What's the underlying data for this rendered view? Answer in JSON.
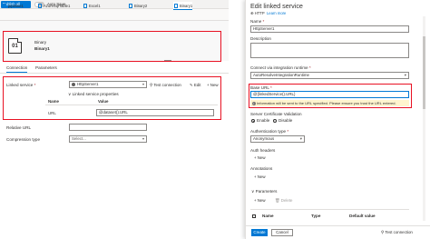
{
  "toolbar": {
    "publish_label": "Publish all",
    "autosave_label": "Auto Save"
  },
  "tabs": [
    {
      "label": "pipeline1"
    },
    {
      "label": "AzureSqlTable1"
    },
    {
      "label": "Excel1"
    },
    {
      "label": "Binary2"
    },
    {
      "label": "Binary1"
    }
  ],
  "dataset": {
    "icon_text": "01",
    "type": "Binary",
    "name": "Binary1"
  },
  "properties_tabs": {
    "connection": "Connection",
    "parameters": "Parameters"
  },
  "connection": {
    "linked_service_label": "Linked service",
    "linked_service_value": "HttpServer1",
    "test_connection": "Test connection",
    "edit": "Edit",
    "new": "New",
    "ls_properties_label": "Linked service properties",
    "grid_name_header": "Name",
    "grid_value_header": "Value",
    "property_name": "URL",
    "property_value": "@dataset().URL",
    "relative_url_label": "Relative URL",
    "compression_type_label": "Compression type",
    "compression_type_value": "Select..."
  },
  "panel": {
    "title": "Edit linked service",
    "subtitle_type": "HTTP",
    "learn_more": "Learn more",
    "name_label": "Name",
    "name_value": "HttpServer1",
    "description_label": "Description",
    "connect_via_label": "Connect via integration runtime",
    "connect_via_value": "AutoResolveIntegrationRuntime",
    "base_url_label": "Base URL",
    "base_url_value": "@{linkedService().URL}",
    "info_message": "Information will be sent to the URL specified. Please ensure you trust the URL entered.",
    "cert_validation_label": "Server Certificate Validation",
    "enable": "Enable",
    "disable": "Disable",
    "auth_type_label": "Authentication type",
    "auth_type_value": "Anonymous",
    "auth_headers_label": "Auth headers",
    "new_label": "New",
    "annotations_label": "Annotations",
    "parameters_label": "Parameters",
    "delete_label": "Delete",
    "param_name_header": "Name",
    "param_type_header": "Type",
    "param_default_header": "Default value",
    "create_button": "Create",
    "cancel_button": "Cancel",
    "test_connection": "Test connection"
  },
  "colors": {
    "accent": "#0078d4",
    "highlight_border": "#e81123",
    "info_background": "#fff4ce"
  }
}
